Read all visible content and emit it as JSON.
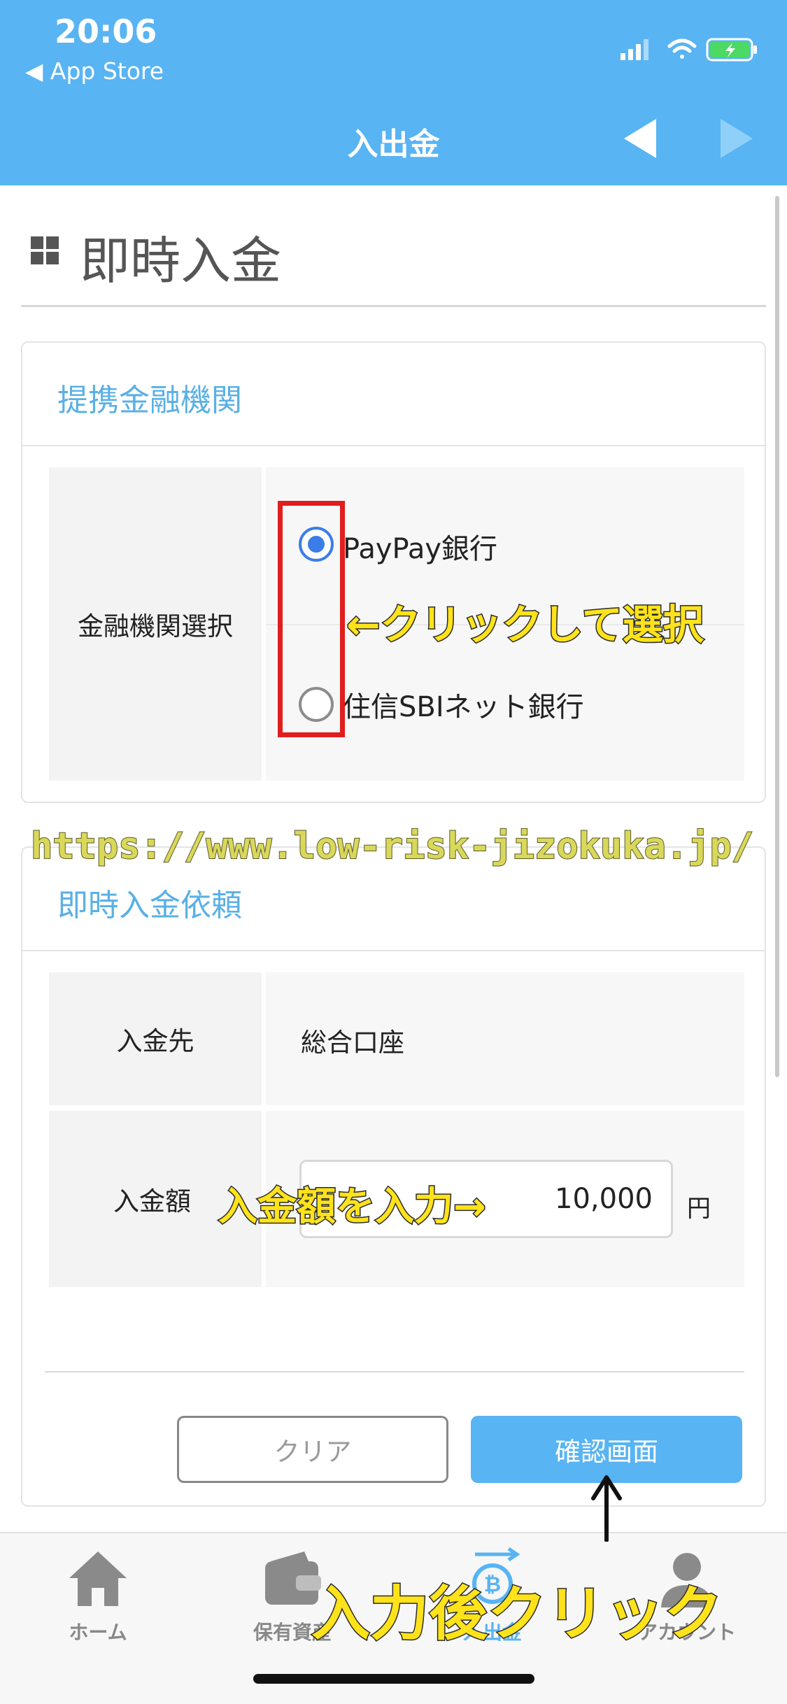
{
  "status_bar": {
    "time": "20:06",
    "back_label": "◀ App Store"
  },
  "nav": {
    "title": "入出金"
  },
  "page": {
    "title": "即時入金"
  },
  "institution_card": {
    "title": "提携金融機関",
    "row_label": "金融機関選択",
    "options": [
      {
        "label": "PayPay銀行",
        "selected": true
      },
      {
        "label": "住信SBIネット銀行",
        "selected": false
      }
    ]
  },
  "deposit_card": {
    "title": "即時入金依頼",
    "destination_label": "入金先",
    "destination_value": "総合口座",
    "amount_label": "入金額",
    "amount_value": "10,000",
    "amount_unit": "円",
    "clear_button": "クリア",
    "confirm_button": "確認画面"
  },
  "tabbar": {
    "items": [
      {
        "label": "ホーム",
        "icon": "home-icon"
      },
      {
        "label": "保有資産",
        "icon": "wallet-icon"
      },
      {
        "label": "入出金",
        "icon": "transfer-icon"
      },
      {
        "label": "アカウント",
        "icon": "account-icon"
      }
    ]
  },
  "annotations": {
    "select_note": "←クリックして選択",
    "amount_note": "入金額を入力→",
    "confirm_note": "入力後クリック",
    "watermark": "https://www.low-risk-jizokuka.jp/"
  },
  "colors": {
    "header": "#58b4f3",
    "accent": "#3b7de8",
    "card_title": "#5ab0e6",
    "callout": "#ffe31a",
    "highlight": "#e11d1d"
  }
}
